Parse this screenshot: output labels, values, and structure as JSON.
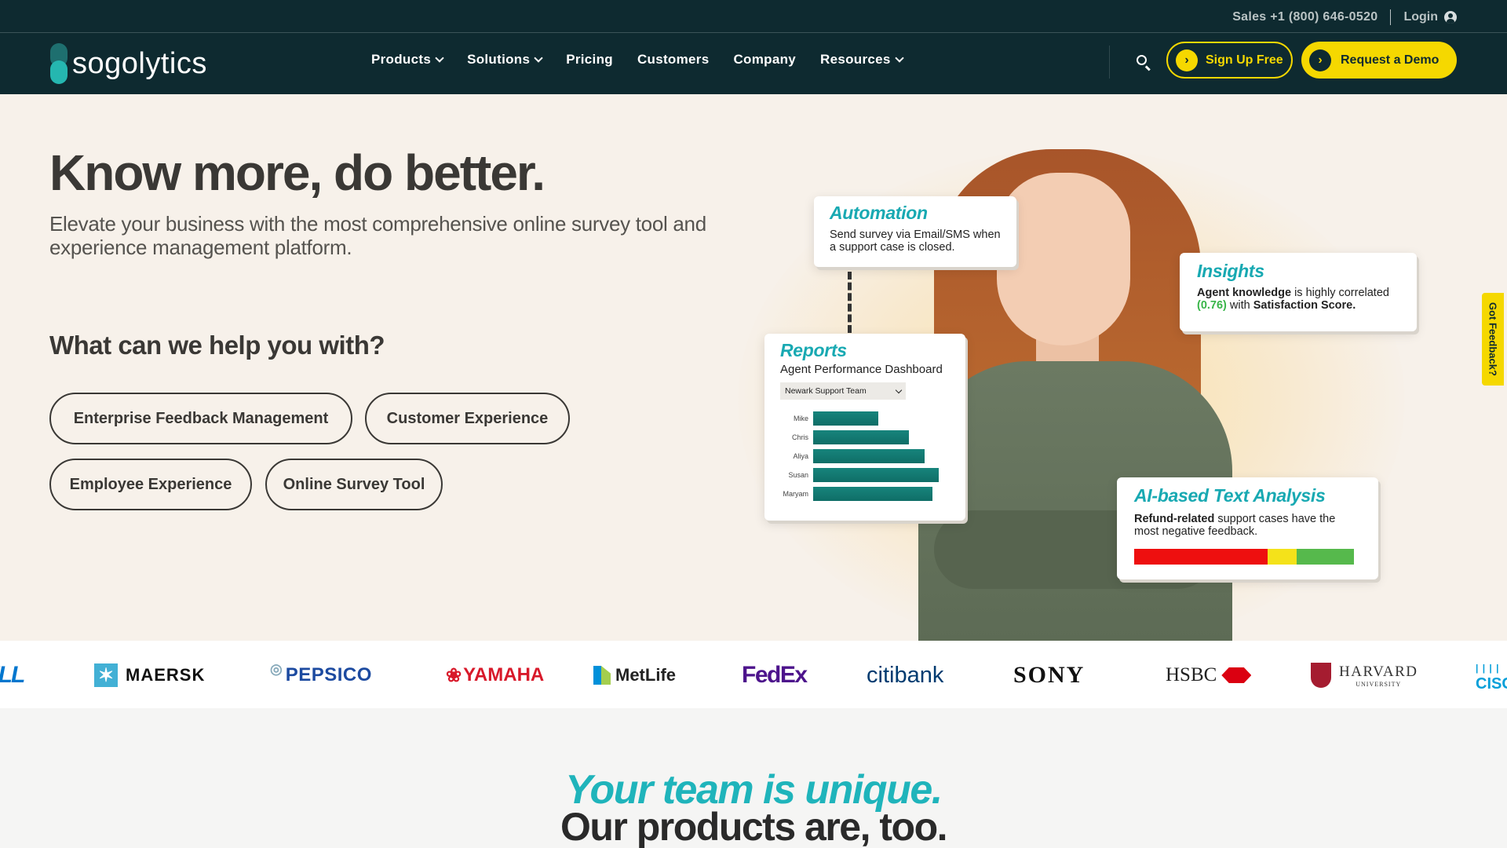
{
  "topbar": {
    "sales": "Sales +1 (800) 646-0520",
    "login": "Login"
  },
  "brand": {
    "name": "sogolytics"
  },
  "nav": {
    "products": "Products",
    "solutions": "Solutions",
    "pricing": "Pricing",
    "customers": "Customers",
    "company": "Company",
    "resources": "Resources"
  },
  "cta": {
    "signup": "Sign Up Free",
    "demo": "Request a Demo"
  },
  "hero": {
    "title": "Know more, do better.",
    "subtitle": "Elevate your business with the most comprehensive online survey tool and experience management platform.",
    "help_title": "What can we help you with?",
    "options": [
      "Enterprise Feedback Management",
      "Customer Experience",
      "Employee Experience",
      "Online Survey Tool"
    ]
  },
  "cards": {
    "automation": {
      "title": "Automation",
      "text": "Send survey via Email/SMS when a support case is closed."
    },
    "insights": {
      "title": "Insights",
      "text_bold1": "Agent knowledge",
      "text_mid": " is highly correlated ",
      "text_value": "(0.76)",
      "text_mid2": " with ",
      "text_bold2": "Satisfaction Score."
    },
    "reports": {
      "title": "Reports",
      "subtitle": "Agent Performance Dashboard",
      "select": "Newark Support Team",
      "bars": [
        {
          "label": "Mike",
          "value": 0.52
        },
        {
          "label": "Chris",
          "value": 0.76
        },
        {
          "label": "Aliya",
          "value": 0.89
        },
        {
          "label": "Susan",
          "value": 1.0
        },
        {
          "label": "Maryam",
          "value": 0.95
        }
      ]
    },
    "ai": {
      "title": "AI-based Text Analysis",
      "text_bold": "Refund-related",
      "text": " support cases have the most negative feedback.",
      "sentiment": {
        "negative": 0.61,
        "neutral": 0.13,
        "positive": 0.26
      }
    }
  },
  "feedback_tab": "Got Feedback?",
  "logos": [
    "DELL",
    "MAERSK",
    "PEPSICO",
    "YAMAHA",
    "MetLife",
    "FedEx",
    "citibank",
    "SONY",
    "HSBC",
    "HARVARD",
    "UNIVERSITY",
    "CISCO"
  ],
  "bottom": {
    "line1": "Your team is unique.",
    "line2": "Our products are, too."
  },
  "colors": {
    "header_bg": "#0e2a30",
    "accent_yellow": "#f5d800",
    "teal": "#1fb4bb",
    "page_bg": "#f7f1ea"
  }
}
